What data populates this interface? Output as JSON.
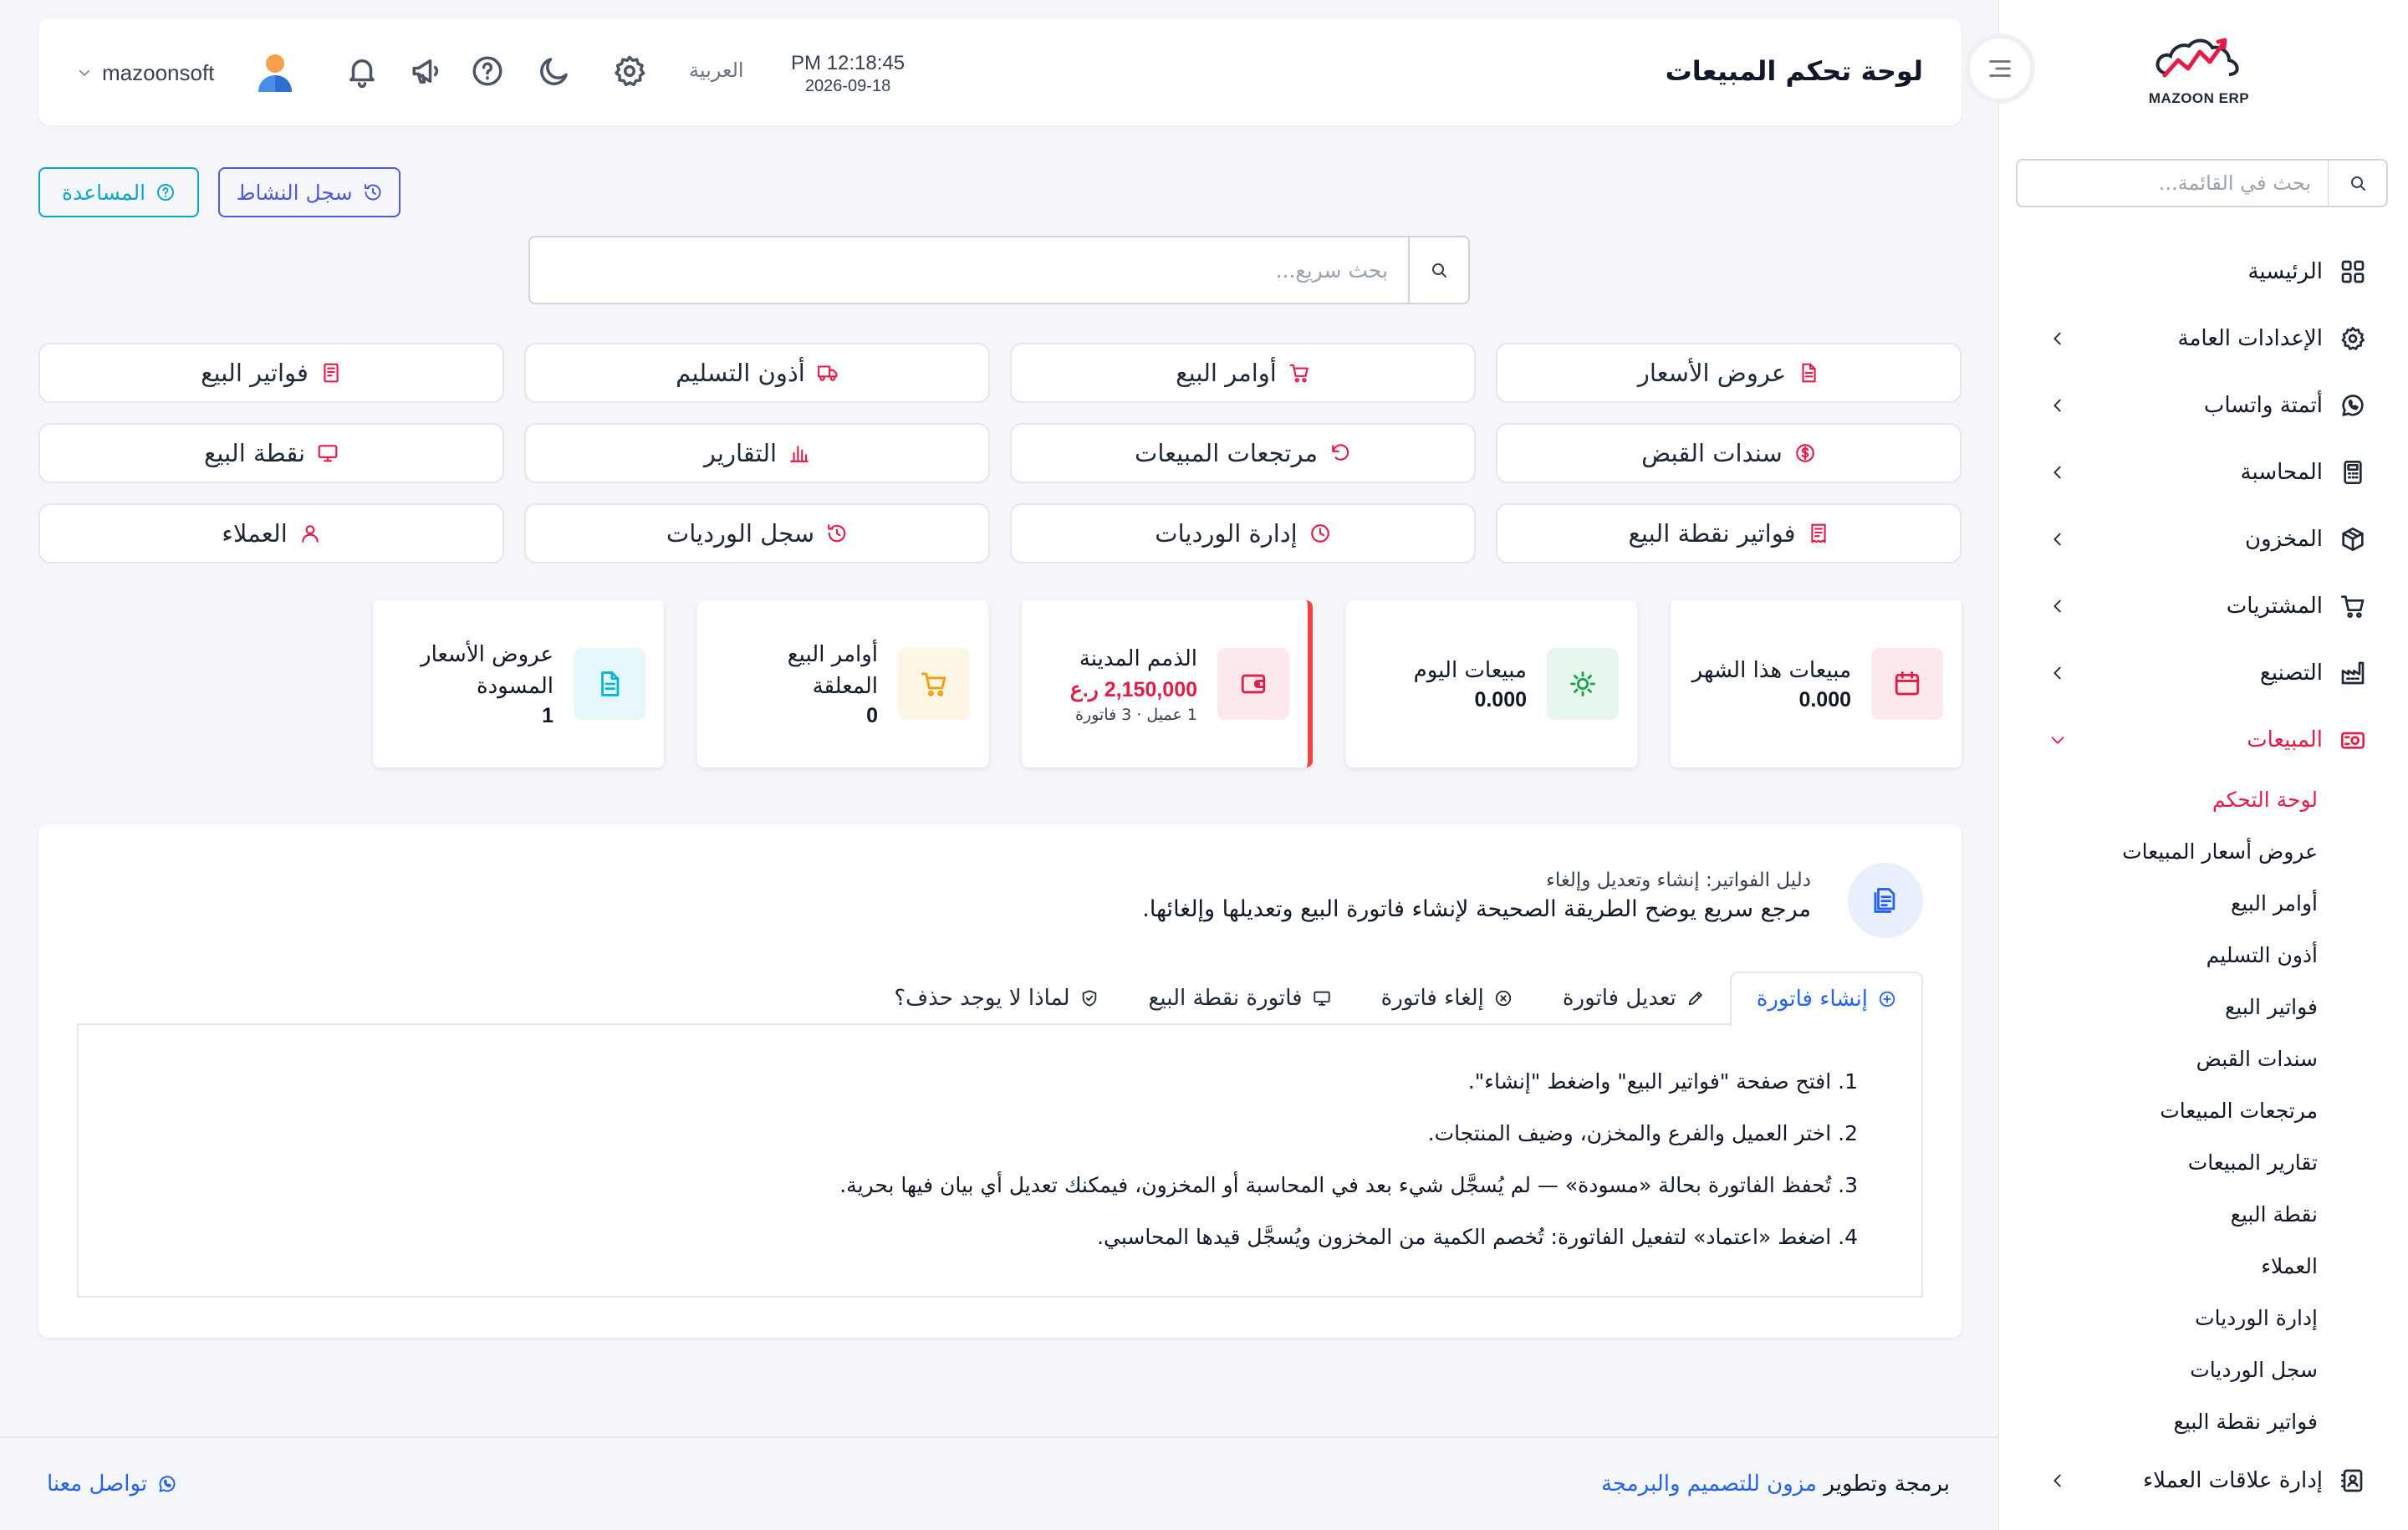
{
  "app": {
    "logo_text": "MAZOON ERP"
  },
  "sidebar": {
    "search_placeholder": "بحث في القائمة...",
    "items": [
      {
        "label": "الرئيسية",
        "icon": "grid-icon"
      },
      {
        "label": "الإعدادات العامة",
        "icon": "gear-icon"
      },
      {
        "label": "أتمتة واتساب",
        "icon": "whatsapp-icon"
      },
      {
        "label": "المحاسبة",
        "icon": "calculator-icon"
      },
      {
        "label": "المخزون",
        "icon": "box-icon"
      },
      {
        "label": "المشتريات",
        "icon": "cart-icon"
      },
      {
        "label": "التصنيع",
        "icon": "factory-icon"
      },
      {
        "label": "المبيعات",
        "icon": "register-icon"
      }
    ],
    "sales_sub": [
      "لوحة التحكم",
      "عروض أسعار المبيعات",
      "أوامر البيع",
      "أذون التسليم",
      "فواتير البيع",
      "سندات القبض",
      "مرتجعات المبيعات",
      "تقارير المبيعات",
      "نقطة البيع",
      "العملاء",
      "إدارة الورديات",
      "سجل الورديات",
      "فواتير نقطة البيع"
    ],
    "last_item": {
      "label": "إدارة علاقات العملاء",
      "icon": "contacts-icon"
    }
  },
  "header": {
    "title": "لوحة تحكم المبيعات",
    "time": "PM 12:18:45",
    "date": "2026-09-18",
    "language": "العربية",
    "username": "mazoonsoft"
  },
  "actions": {
    "activity_log": "سجل النشاط",
    "help": "المساعدة"
  },
  "quick_search": {
    "placeholder": "بحث سريع..."
  },
  "quick_links": [
    {
      "label": "عروض الأسعار",
      "icon": "document-icon"
    },
    {
      "label": "أوامر البيع",
      "icon": "cart-icon"
    },
    {
      "label": "أذون التسليم",
      "icon": "truck-icon"
    },
    {
      "label": "فواتير البيع",
      "icon": "invoice-icon"
    },
    {
      "label": "سندات القبض",
      "icon": "dollar-circle-icon"
    },
    {
      "label": "مرتجعات المبيعات",
      "icon": "undo-icon"
    },
    {
      "label": "التقارير",
      "icon": "bar-chart-icon"
    },
    {
      "label": "نقطة البيع",
      "icon": "monitor-icon"
    },
    {
      "label": "فواتير نقطة البيع",
      "icon": "receipt-icon"
    },
    {
      "label": "إدارة الورديات",
      "icon": "clock-icon"
    },
    {
      "label": "سجل الورديات",
      "icon": "history-icon"
    },
    {
      "label": "العملاء",
      "icon": "user-icon"
    }
  ],
  "stats": [
    {
      "title": "مبيعات هذا الشهر",
      "value": "0.000",
      "icon": "calendar-icon",
      "color": "#e11d48",
      "bg": "#fde8ec"
    },
    {
      "title": "مبيعات اليوم",
      "value": "0.000",
      "icon": "sun-icon",
      "color": "#16a34a",
      "bg": "#e7f7ee"
    },
    {
      "title": "الذمم المدينة",
      "value": "2,150,000 ر.ع",
      "sub": "1 عميل · 3 فاتورة",
      "icon": "wallet-icon",
      "color": "#e11d48",
      "bg": "#fde8ec"
    },
    {
      "title": "أوامر البيع المعلقة",
      "value": "0",
      "icon": "cart-icon",
      "color": "#f59e0b",
      "bg": "#fef6e4"
    },
    {
      "title": "عروض الأسعار المسودة",
      "value": "1",
      "icon": "document-icon",
      "color": "#06b6d4",
      "bg": "#e6f7fb"
    }
  ],
  "guide": {
    "kicker": "دليل الفواتير: إنشاء وتعديل وإلغاء",
    "description": "مرجع سريع يوضح الطريقة الصحيحة لإنشاء فاتورة البيع وتعديلها وإلغائها.",
    "tabs": [
      {
        "label": "إنشاء فاتورة",
        "icon": "plus-circle-icon"
      },
      {
        "label": "تعديل فاتورة",
        "icon": "pencil-icon"
      },
      {
        "label": "إلغاء فاتورة",
        "icon": "x-circle-icon"
      },
      {
        "label": "فاتورة نقطة البيع",
        "icon": "monitor-icon"
      },
      {
        "label": "لماذا لا يوجد حذف؟",
        "icon": "shield-icon"
      }
    ],
    "steps": [
      "1. افتح صفحة \"فواتير البيع\" واضغط \"إنشاء\".",
      "2. اختر العميل والفرع والمخزن، وضيف المنتجات.",
      "3. تُحفظ الفاتورة بحالة «مسودة» — لم يُسجَّل شيء بعد في المحاسبة أو المخزون، فيمكنك تعديل أي بيان فيها بحرية.",
      "4. اضغط «اعتماد» لتفعيل الفاتورة: تُخصم الكمية من المخزون ويُسجَّل قيدها المحاسبي."
    ]
  },
  "footer": {
    "credit_prefix": "برمجة وتطوير",
    "credit_link": "مزون للتصميم والبرمجة",
    "contact": "تواصل معنا"
  },
  "colors": {
    "accent": "#e11d48",
    "link": "#2563eb",
    "activity_btn": "#4f5bd5",
    "help_btn": "#0ea5c6"
  }
}
